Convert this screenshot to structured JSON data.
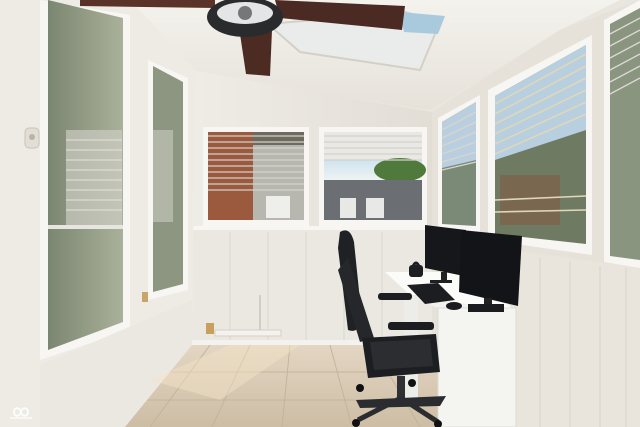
{
  "scene": {
    "description_colors": {
      "wall": "#ece9e2",
      "ceiling": "#f1efea",
      "floor": "#d9cbb4",
      "trim": "#f7f6f3",
      "chair": "#1d1f22",
      "desk": "#f5f5f3",
      "monitor": "#141618",
      "fan_blade": "#4a2a22"
    }
  },
  "watermark": {
    "icon": "infinity-logo-icon"
  }
}
